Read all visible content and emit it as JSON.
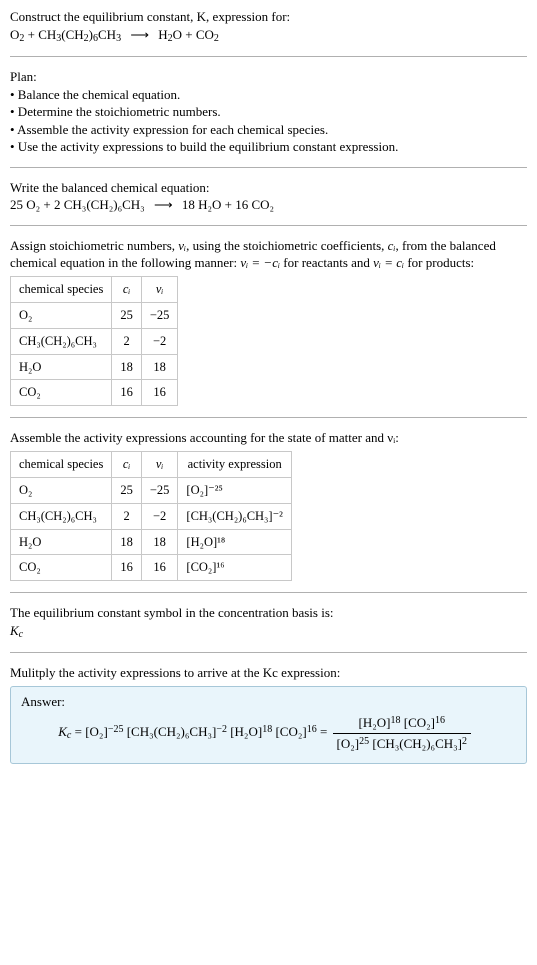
{
  "intro": {
    "title_line1": "Construct the equilibrium constant, K, expression for:",
    "reaction_lhs_pre": "O",
    "reaction_lhs_sub1": "2",
    "reaction_lhs_plus": " + CH",
    "reaction_lhs_sub2": "3",
    "reaction_lhs_mid": "(CH",
    "reaction_lhs_sub3": "2",
    "reaction_lhs_end1": ")",
    "reaction_lhs_sub4": "6",
    "reaction_lhs_end2": "CH",
    "reaction_lhs_sub5": "3",
    "arrow": "⟶",
    "reaction_rhs_pre": "H",
    "reaction_rhs_sub1": "2",
    "reaction_rhs_mid": "O + CO",
    "reaction_rhs_sub2": "2"
  },
  "plan": {
    "heading": "Plan:",
    "b1": "• Balance the chemical equation.",
    "b2": "• Determine the stoichiometric numbers.",
    "b3": "• Assemble the activity expression for each chemical species.",
    "b4": "• Use the activity expressions to build the equilibrium constant expression."
  },
  "balanced": {
    "heading": "Write the balanced chemical equation:",
    "lhs": "25 O₂ + 2 CH₃(CH₂)₆CH₃",
    "arrow": "⟶",
    "rhs": "18 H₂O + 16 CO₂"
  },
  "stoich_text": {
    "p1a": "Assign stoichiometric numbers, ",
    "nu_i": "νᵢ",
    "p1b": ", using the stoichiometric coefficients, ",
    "c_i": "cᵢ",
    "p1c": ", from the balanced chemical equation in the following manner: ",
    "eq1": "νᵢ = −cᵢ",
    "p1d": " for reactants and ",
    "eq2": "νᵢ = cᵢ",
    "p1e": " for products:"
  },
  "table1": {
    "h1": "chemical species",
    "h2": "cᵢ",
    "h3": "νᵢ",
    "r1_species": "O₂",
    "r1_c": "25",
    "r1_nu": "−25",
    "r2_species": "CH₃(CH₂)₆CH₃",
    "r2_c": "2",
    "r2_nu": "−2",
    "r3_species": "H₂O",
    "r3_c": "18",
    "r3_nu": "18",
    "r4_species": "CO₂",
    "r4_c": "16",
    "r4_nu": "16"
  },
  "activity_heading": "Assemble the activity expressions accounting for the state of matter and νᵢ:",
  "table2": {
    "h1": "chemical species",
    "h2": "cᵢ",
    "h3": "νᵢ",
    "h4": "activity expression",
    "r1_species": "O₂",
    "r1_c": "25",
    "r1_nu": "−25",
    "r1_act": "[O₂]⁻²⁵",
    "r2_species": "CH₃(CH₂)₆CH₃",
    "r2_c": "2",
    "r2_nu": "−2",
    "r2_act": "[CH₃(CH₂)₆CH₃]⁻²",
    "r3_species": "H₂O",
    "r3_c": "18",
    "r3_nu": "18",
    "r3_act": "[H₂O]¹⁸",
    "r4_species": "CO₂",
    "r4_c": "16",
    "r4_nu": "16",
    "r4_act": "[CO₂]¹⁶"
  },
  "kc_intro": {
    "line1": "The equilibrium constant symbol in the concentration basis is:",
    "symbol": "K",
    "symbol_sub": "c"
  },
  "multiply": {
    "line": "Mulitply the activity expressions to arrive at the Kc expression:"
  },
  "answer": {
    "label": "Answer:",
    "kc": "K",
    "kc_sub": "c",
    "eq": " = ",
    "t1": "[O₂]",
    "e1": "−25",
    "t2": " [CH₃(CH₂)₆CH₃]",
    "e2": "−2",
    "t3": " [H₂O]",
    "e3": "18",
    "t4": " [CO₂]",
    "e4": "16",
    "eq2": " = ",
    "num1": "[H₂O]",
    "num1e": "18",
    "num2": " [CO₂]",
    "num2e": "16",
    "den1": "[O₂]",
    "den1e": "25",
    "den2": " [CH₃(CH₂)₆CH₃]",
    "den2e": "2"
  },
  "chart_data": {
    "type": "table",
    "tables": [
      {
        "title": "Stoichiometric numbers",
        "columns": [
          "chemical species",
          "c_i",
          "nu_i"
        ],
        "rows": [
          [
            "O2",
            25,
            -25
          ],
          [
            "CH3(CH2)6CH3",
            2,
            -2
          ],
          [
            "H2O",
            18,
            18
          ],
          [
            "CO2",
            16,
            16
          ]
        ]
      },
      {
        "title": "Activity expressions",
        "columns": [
          "chemical species",
          "c_i",
          "nu_i",
          "activity expression"
        ],
        "rows": [
          [
            "O2",
            25,
            -25,
            "[O2]^-25"
          ],
          [
            "CH3(CH2)6CH3",
            2,
            -2,
            "[CH3(CH2)6CH3]^-2"
          ],
          [
            "H2O",
            18,
            18,
            "[H2O]^18"
          ],
          [
            "CO2",
            16,
            16,
            "[CO2]^16"
          ]
        ]
      }
    ]
  }
}
